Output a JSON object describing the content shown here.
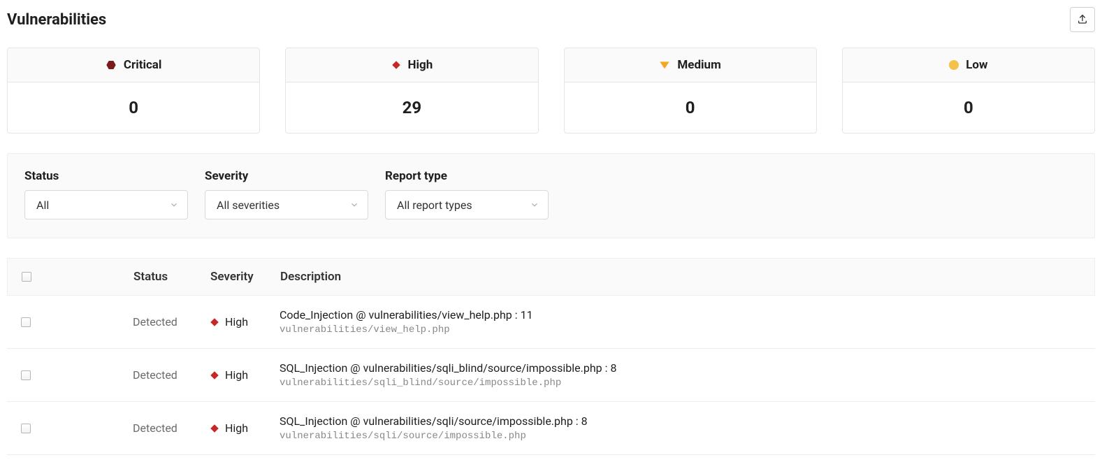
{
  "page": {
    "title": "Vulnerabilities"
  },
  "colors": {
    "critical": "#7a1b1b",
    "high": "#c62828",
    "medium": "#f5a623",
    "low": "#f4c24b"
  },
  "summary": [
    {
      "level": "critical",
      "label": "Critical",
      "count": 0
    },
    {
      "level": "high",
      "label": "High",
      "count": 29
    },
    {
      "level": "medium",
      "label": "Medium",
      "count": 0
    },
    {
      "level": "low",
      "label": "Low",
      "count": 0
    }
  ],
  "filters": {
    "status": {
      "label": "Status",
      "value": "All"
    },
    "severity": {
      "label": "Severity",
      "value": "All severities"
    },
    "report_type": {
      "label": "Report type",
      "value": "All report types"
    }
  },
  "table": {
    "headers": {
      "status": "Status",
      "severity": "Severity",
      "description": "Description"
    },
    "rows": [
      {
        "status": "Detected",
        "severity_level": "high",
        "severity_label": "High",
        "title": "Code_Injection @ vulnerabilities/view_help.php : 11",
        "path": "vulnerabilities/view_help.php"
      },
      {
        "status": "Detected",
        "severity_level": "high",
        "severity_label": "High",
        "title": "SQL_Injection @ vulnerabilities/sqli_blind/source/impossible.php : 8",
        "path": "vulnerabilities/sqli_blind/source/impossible.php"
      },
      {
        "status": "Detected",
        "severity_level": "high",
        "severity_label": "High",
        "title": "SQL_Injection @ vulnerabilities/sqli/source/impossible.php : 8",
        "path": "vulnerabilities/sqli/source/impossible.php"
      }
    ]
  }
}
